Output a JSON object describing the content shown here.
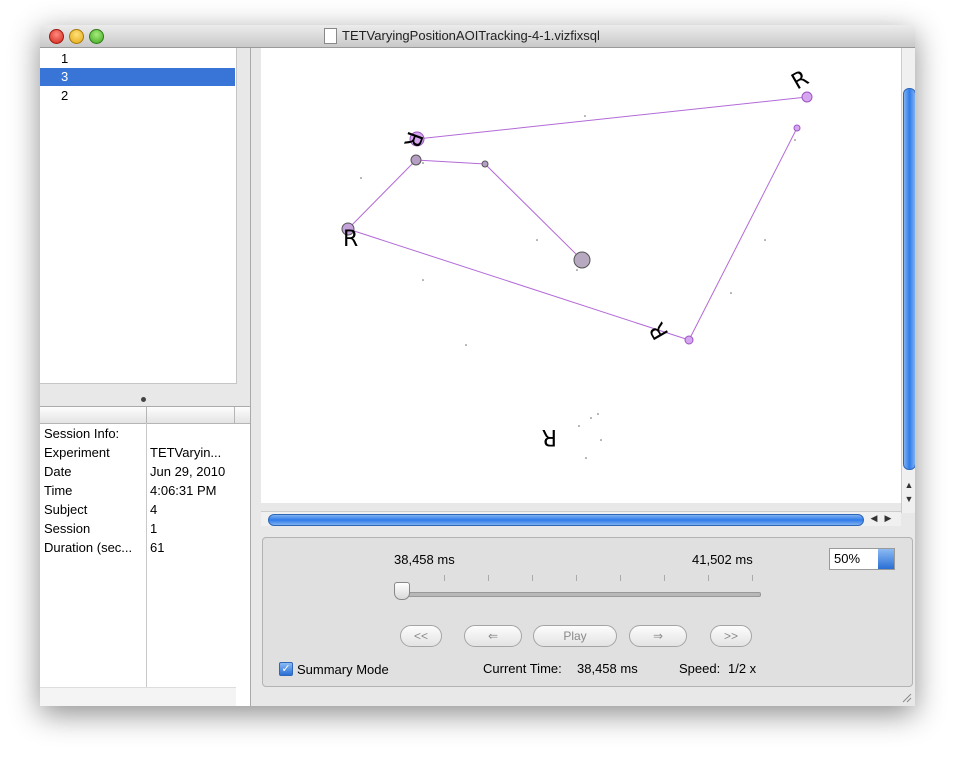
{
  "window": {
    "title": "TETVaryingPositionAOITracking-4-1.vizfixsql"
  },
  "session_list": {
    "items": [
      {
        "label": "1",
        "selected": false
      },
      {
        "label": "3",
        "selected": true
      },
      {
        "label": "2",
        "selected": false
      }
    ]
  },
  "session_info": {
    "rows": [
      {
        "key": "Session Info:",
        "value": ""
      },
      {
        "key": "Experiment",
        "value": "TETVaryin..."
      },
      {
        "key": "Date",
        "value": "Jun 29, 2010"
      },
      {
        "key": "Time",
        "value": "4:06:31 PM"
      },
      {
        "key": "Subject",
        "value": "4"
      },
      {
        "key": "Session",
        "value": "1"
      },
      {
        "key": "Duration (sec...",
        "value": "61"
      }
    ]
  },
  "canvas": {
    "letter": "R",
    "path_color": "#b36ad8",
    "fixation_fill": "#d6a6f0"
  },
  "controls": {
    "start_time": "38,458 ms",
    "end_time": "41,502 ms",
    "zoom_value": "50%",
    "buttons": {
      "first": "<<",
      "prev": "⇐",
      "play": "Play",
      "next": "⇒",
      "last": ">>"
    },
    "summary_mode_label": "Summary Mode",
    "summary_mode_checked": true,
    "current_time_label": "Current Time:",
    "current_time_value": "38,458 ms",
    "speed_label": "Speed:",
    "speed_value": "1/2 x"
  },
  "colors": {
    "selection": "#3875d7",
    "scroll_accent": "#2f7bea"
  }
}
